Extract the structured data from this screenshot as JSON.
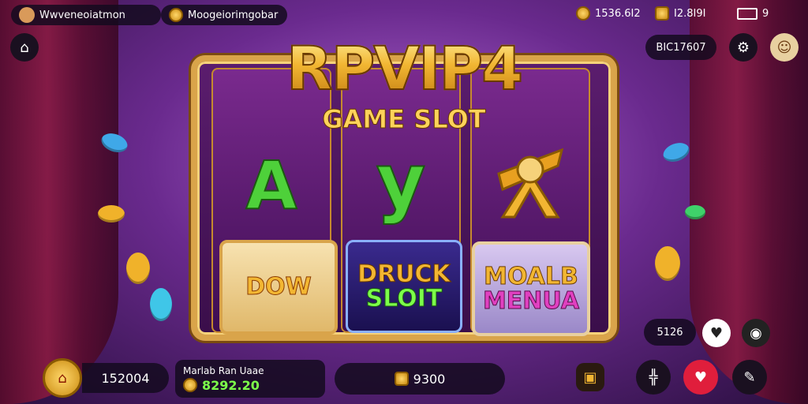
{
  "top_bar": {
    "player_name": "Wwveneoiatmon",
    "game_name": "Moogeiorimgobar",
    "coin_balance": "1536.6I2",
    "gem_balance": "I2.8I9I",
    "battery_label": "9",
    "account_id": "BIC17607"
  },
  "logo": {
    "main": "RPVIP4",
    "sub": "GAME SLOT"
  },
  "reels": {
    "symbol_1": "A",
    "symbol_2": "y",
    "tile_1": "DOW",
    "tile_2_line1": "DRUCK",
    "tile_2_line2": "SLOIT",
    "tile_3_line1": "MOALB",
    "tile_3_line2": "MENUA"
  },
  "bottom_bar": {
    "balance": "152004",
    "win_label": "Marlab Ran Uaae",
    "win_value": "8292.20",
    "bet_value": "9300",
    "side_value": "5126"
  },
  "colors": {
    "gold": "#f2b632",
    "purple": "#6a2a8e",
    "green_text": "#7cff4a",
    "red_button": "#e01e3c"
  }
}
